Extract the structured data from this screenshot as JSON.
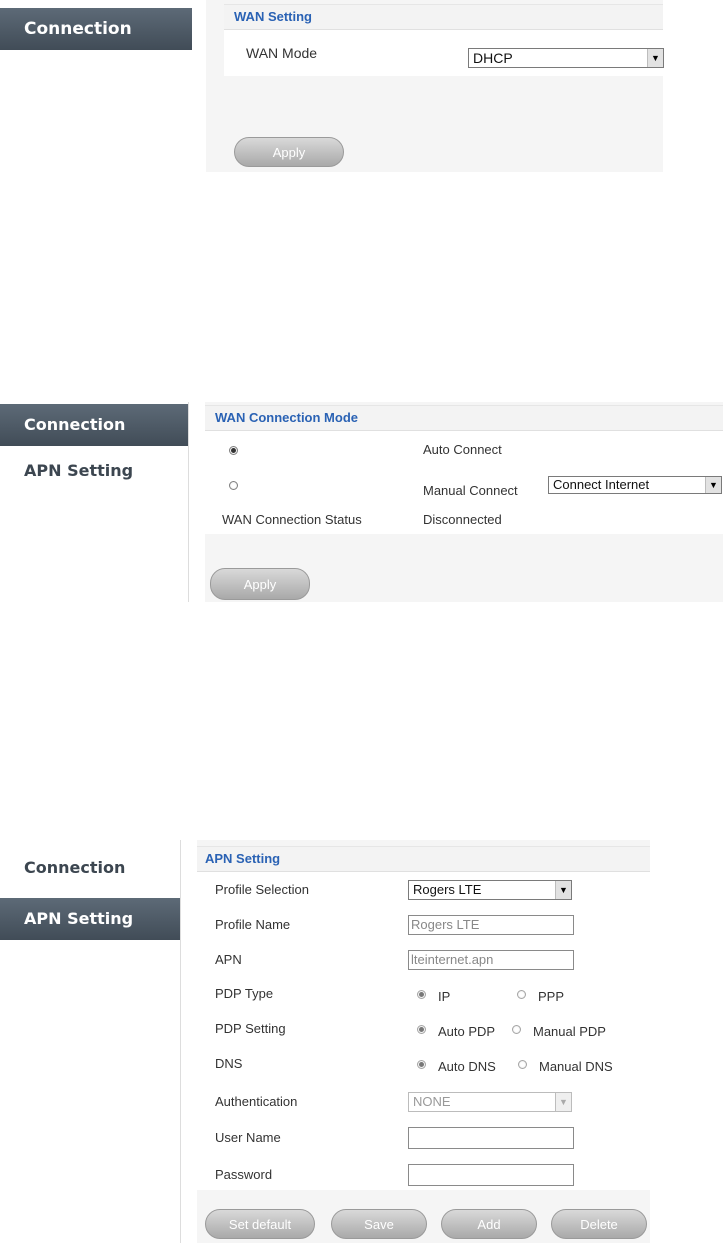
{
  "panel1": {
    "sidebar": {
      "items": [
        {
          "label": "Connection"
        }
      ]
    },
    "section_title": "WAN Setting",
    "wan_mode_label": "WAN Mode",
    "wan_mode_value": "DHCP",
    "apply_label": "Apply"
  },
  "panel2": {
    "sidebar": {
      "items": [
        {
          "label": "Connection"
        },
        {
          "label": "APN Setting"
        }
      ]
    },
    "section_title": "WAN Connection Mode",
    "auto_connect_label": "Auto Connect",
    "manual_connect_label": "Manual Connect",
    "manual_connect_value": "Connect Internet",
    "status_label": "WAN Connection Status",
    "status_value": "Disconnected",
    "apply_label": "Apply"
  },
  "panel3": {
    "sidebar": {
      "items": [
        {
          "label": "Connection"
        },
        {
          "label": "APN Setting"
        }
      ]
    },
    "section_title": "APN Setting",
    "fields": {
      "profile_selection_label": "Profile Selection",
      "profile_selection_value": "Rogers LTE",
      "profile_name_label": "Profile Name",
      "profile_name_value": "Rogers LTE",
      "apn_label": "APN",
      "apn_value": "lteinternet.apn",
      "pdp_type_label": "PDP Type",
      "pdp_type_options": [
        "IP",
        "PPP"
      ],
      "pdp_setting_label": "PDP Setting",
      "pdp_setting_options": [
        "Auto PDP",
        "Manual PDP"
      ],
      "dns_label": "DNS",
      "dns_options": [
        "Auto DNS",
        "Manual DNS"
      ],
      "authentication_label": "Authentication",
      "authentication_value": "NONE",
      "user_name_label": "User Name",
      "user_name_value": "",
      "password_label": "Password",
      "password_value": ""
    },
    "buttons": [
      "Set default",
      "Save",
      "Add",
      "Delete"
    ]
  },
  "icons": {
    "dropdown_arrow": "▼"
  },
  "colors": {
    "accent": "#2a62b4",
    "nav_active": "#4b5661"
  }
}
